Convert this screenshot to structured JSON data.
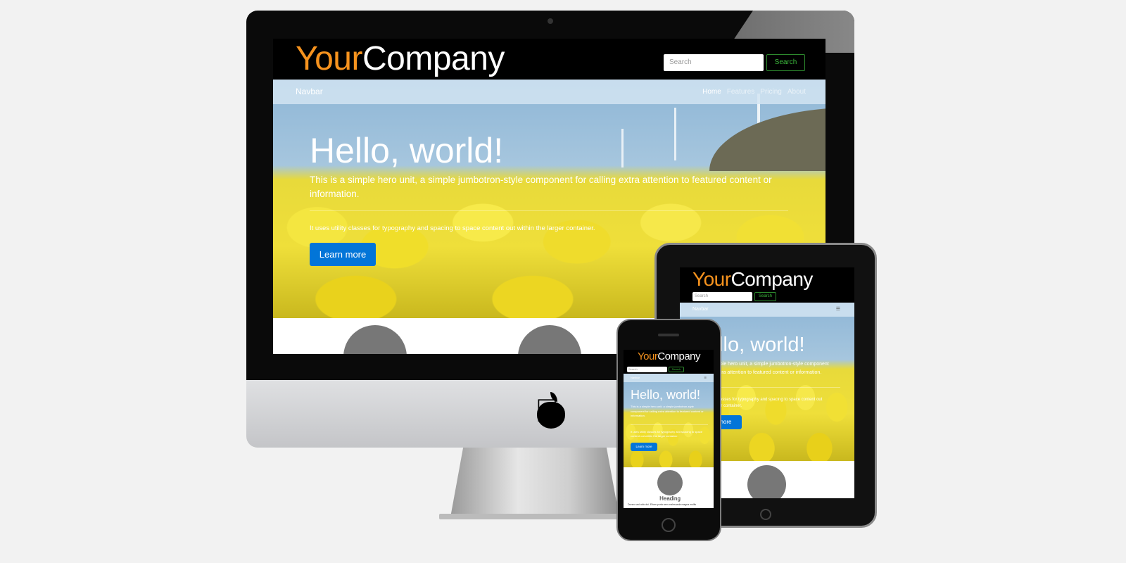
{
  "site": {
    "logo_part1": "Your",
    "logo_part2": "Company",
    "search_placeholder": "Search",
    "search_button": "Search",
    "navbar_brand": "Navbar",
    "nav_links": [
      "Home",
      "Features",
      "Pricing",
      "About"
    ],
    "hero_title": "Hello, world!",
    "hero_lead": "This is a simple hero unit, a simple jumbotron-style component for calling extra attention to featured content or information.",
    "hero_text": "It uses utility classes for typography and spacing to space content out within the larger container.",
    "learn_more": "Learn more",
    "heading": "Heading",
    "body_text": "Donec sed odio dui. Etiam porta sem malesuada magna mollis",
    "menu_icon": "☰"
  },
  "colors": {
    "accent": "#f7931e",
    "primary": "#0275d8",
    "search_green": "#3cb83c"
  }
}
